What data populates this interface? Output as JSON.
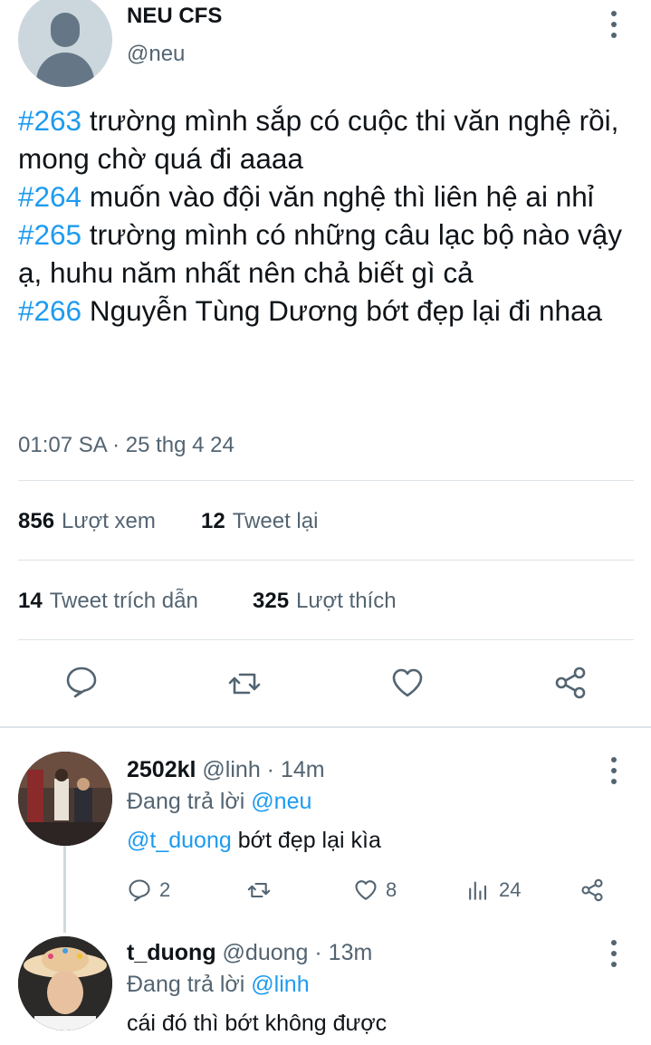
{
  "tweet": {
    "author": {
      "name": "NEU CFS",
      "handle": "@neu"
    },
    "lines": [
      {
        "tag": "#263",
        "text": " trường mình sắp có cuộc thi văn nghệ rồi, mong chờ quá đi aaaa"
      },
      {
        "tag": "#264",
        "text": " muốn vào đội văn nghệ thì liên hệ ai nhỉ"
      },
      {
        "tag": "#265",
        "text": " trường mình có những câu lạc bộ nào vậy ạ, huhu năm nhất nên chả biết gì cả"
      },
      {
        "tag": "#266",
        "text": " Nguyễn Tùng Dương bớt đẹp lại đi nhaa"
      }
    ],
    "timestamp": "01:07 SA · 25 thg 4 24",
    "stats": {
      "views_count": "856",
      "views_label": "Lượt xem",
      "retweets_count": "12",
      "retweets_label": "Tweet lại",
      "quotes_count": "14",
      "quotes_label": "Tweet trích dẫn",
      "likes_count": "325",
      "likes_label": "Lượt thích"
    },
    "actions": [
      "reply-icon",
      "retweet-icon",
      "like-icon",
      "share-icon"
    ]
  },
  "replies": [
    {
      "name": "2502kl",
      "handle": "@linh",
      "time": "· 14m",
      "replying_label": "Đang trả lời",
      "replying_to": "@neu",
      "mention": "@t_duong",
      "text": " bớt đẹp lại kìa",
      "reply_count": "2",
      "like_count": "8",
      "view_count": "24"
    },
    {
      "name": "t_duong",
      "handle": "@duong",
      "time": "· 13m",
      "replying_label": "Đang trả lời",
      "replying_to": "@linh",
      "text": "cái đó thì bớt không được"
    }
  ],
  "colors": {
    "accent": "#1d9bf0",
    "text": "#0f1419",
    "muted": "#536471",
    "divider": "#dde3e8"
  }
}
